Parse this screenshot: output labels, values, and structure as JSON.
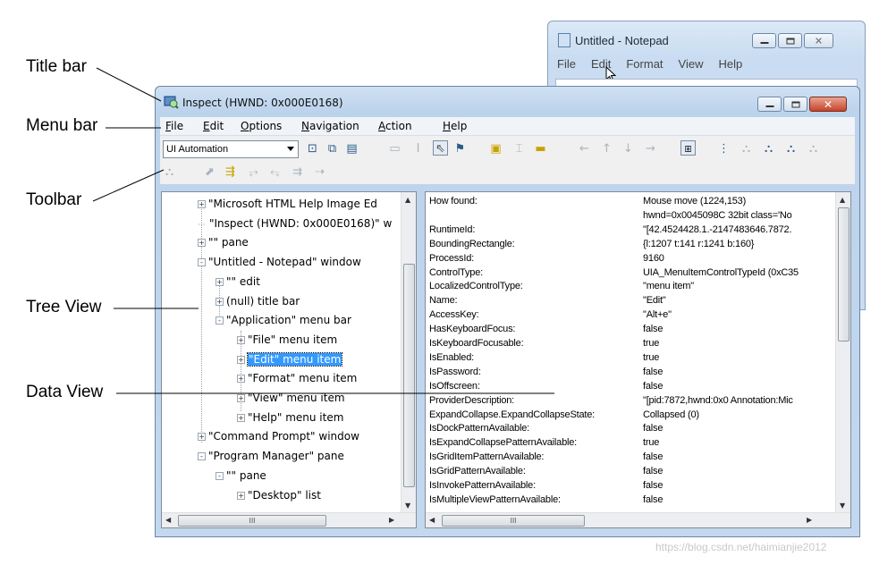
{
  "callouts": {
    "title_bar": "Title bar",
    "menu_bar": "Menu bar",
    "toolbar": "Toolbar",
    "tree_view": "Tree View",
    "data_view": "Data View"
  },
  "notepad": {
    "title": "Untitled - Notepad",
    "menu": [
      "File",
      "Edit",
      "Format",
      "View",
      "Help"
    ]
  },
  "inspect": {
    "title": "Inspect  (HWND: 0x000E0168)",
    "menu": [
      "File",
      "Edit",
      "Options",
      "Navigation",
      "Action",
      "Help"
    ],
    "combo_value": "UI Automation"
  },
  "tree": [
    {
      "label": "\"Microsoft HTML Help Image Ed",
      "expander": "+",
      "indent": 0
    },
    {
      "label": "\"Inspect  (HWND: 0x000E0168)\" w",
      "expander": "",
      "indent": 0
    },
    {
      "label": "\"\" pane",
      "expander": "+",
      "indent": 0
    },
    {
      "label": "\"Untitled - Notepad\" window",
      "expander": "-",
      "indent": 0
    },
    {
      "label": "\"\" edit",
      "expander": "+",
      "indent": 1
    },
    {
      "label": "(null) title bar",
      "expander": "+",
      "indent": 1
    },
    {
      "label": "\"Application\" menu bar",
      "expander": "-",
      "indent": 1
    },
    {
      "label": "\"File\" menu item",
      "expander": "+",
      "indent": 2
    },
    {
      "label": "\"Edit\" menu item",
      "expander": "+",
      "indent": 2,
      "selected": true
    },
    {
      "label": "\"Format\" menu item",
      "expander": "+",
      "indent": 2
    },
    {
      "label": "\"View\" menu item",
      "expander": "+",
      "indent": 2
    },
    {
      "label": "\"Help\" menu item",
      "expander": "+",
      "indent": 2
    },
    {
      "label": "\"Command Prompt\" window",
      "expander": "+",
      "indent": 0
    },
    {
      "label": "\"Program Manager\" pane",
      "expander": "-",
      "indent": 0
    },
    {
      "label": "\"\" pane",
      "expander": "-",
      "indent": 1
    },
    {
      "label": "\"Desktop\" list",
      "expander": "+",
      "indent": 2
    }
  ],
  "properties": [
    {
      "name": "How found:",
      "value": "Mouse move (1224,153)"
    },
    {
      "name": "",
      "value": "hwnd=0x0045098C 32bit class='No"
    },
    {
      "name": "RuntimeId:",
      "value": "\"[42.4524428.1.-2147483646.7872."
    },
    {
      "name": "BoundingRectangle:",
      "value": "{l:1207 t:141 r:1241 b:160}"
    },
    {
      "name": "ProcessId:",
      "value": "9160"
    },
    {
      "name": "ControlType:",
      "value": "UIA_MenuItemControlTypeId (0xC35"
    },
    {
      "name": "LocalizedControlType:",
      "value": "\"menu item\""
    },
    {
      "name": "Name:",
      "value": "\"Edit\""
    },
    {
      "name": "AccessKey:",
      "value": "\"Alt+e\""
    },
    {
      "name": "HasKeyboardFocus:",
      "value": "false"
    },
    {
      "name": "IsKeyboardFocusable:",
      "value": "true"
    },
    {
      "name": "IsEnabled:",
      "value": "true"
    },
    {
      "name": "IsPassword:",
      "value": "false"
    },
    {
      "name": "IsOffscreen:",
      "value": "false"
    },
    {
      "name": "ProviderDescription:",
      "value": "\"[pid:7872,hwnd:0x0 Annotation:Mic"
    },
    {
      "name": "ExpandCollapse.ExpandCollapseState:",
      "value": "Collapsed (0)"
    },
    {
      "name": "IsDockPatternAvailable:",
      "value": "false"
    },
    {
      "name": "IsExpandCollapsePatternAvailable:",
      "value": "true"
    },
    {
      "name": "IsGridItemPatternAvailable:",
      "value": "false"
    },
    {
      "name": "IsGridPatternAvailable:",
      "value": "false"
    },
    {
      "name": "IsInvokePatternAvailable:",
      "value": "false"
    },
    {
      "name": "IsMultipleViewPatternAvailable:",
      "value": "false"
    }
  ],
  "scroll": {
    "thumb_glyph": "III"
  },
  "watermark": "https://blog.csdn.net/haimianjie2012"
}
